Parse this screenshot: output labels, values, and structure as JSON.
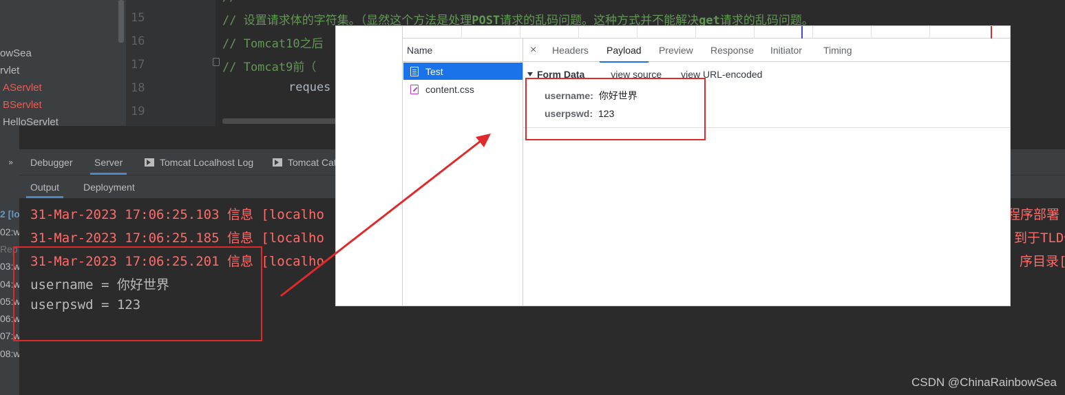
{
  "project_tree": {
    "items": [
      {
        "label": "owSea",
        "color": "#bbbbbb"
      },
      {
        "label": "rvlet",
        "color": "#bbbbbb"
      },
      {
        "label": "AServlet",
        "color": "#e55e52"
      },
      {
        "label": "BServlet",
        "color": "#e55e52"
      },
      {
        "label": "HelloServlet",
        "color": "#bbbbbb"
      }
    ]
  },
  "editor": {
    "line_numbers": [
      "15",
      "16",
      "17",
      "18",
      "19"
    ],
    "line_top": "//",
    "line15": {
      "p1": "// 设置请求体的字符集。（显然这个方法是处理",
      "b1": "POST",
      "p2": "请求的乱码问题。这种方式并不能解决",
      "b2": "get",
      "p3": "请求的乱码问题。"
    },
    "line16": "// Tomcat10之后",
    "line17": "// Tomcat9前（",
    "line18": "reques"
  },
  "tool_window": {
    "chevron": "»",
    "tabs": [
      "Debugger",
      "Server",
      "Tomcat Localhost Log",
      "Tomcat Cat"
    ],
    "subtabs": [
      "Output",
      "Deployment"
    ],
    "deployments": [
      "2 [lo",
      "02:w",
      "Rep",
      "03:w",
      "04:w",
      "05:w",
      "06:w",
      "07:w",
      "08:w"
    ]
  },
  "console": {
    "lines": [
      "31-Mar-2023 17:06:25.103 信息 [localho",
      "31-Mar-2023 17:06:25.185 信息 [localho",
      "31-Mar-2023 17:06:25.201 信息 [localho",
      "username = 你好世界",
      "userpswd = 123"
    ],
    "right_tails": [
      "程序部署",
      "到于TLD但",
      "序目录[D:"
    ]
  },
  "devtools": {
    "name_header": "Name",
    "requests": [
      {
        "name": "Test",
        "selected": true,
        "icon": "document-icon"
      },
      {
        "name": "content.css",
        "selected": false,
        "icon": "stylesheet-icon"
      }
    ],
    "close_glyph": "×",
    "tabs": [
      "Headers",
      "Payload",
      "Preview",
      "Response",
      "Initiator",
      "Timing"
    ],
    "active_tab": "Payload",
    "form_data": {
      "title": "Form Data",
      "view_source": "view source",
      "view_url_encoded": "view URL-encoded",
      "fields": [
        {
          "key": "username:",
          "value": "你好世界"
        },
        {
          "key": "userpswd:",
          "value": "123"
        }
      ]
    }
  },
  "annotation": {
    "color": "#e02a2a"
  },
  "watermark": "CSDN @ChinaRainbowSea"
}
